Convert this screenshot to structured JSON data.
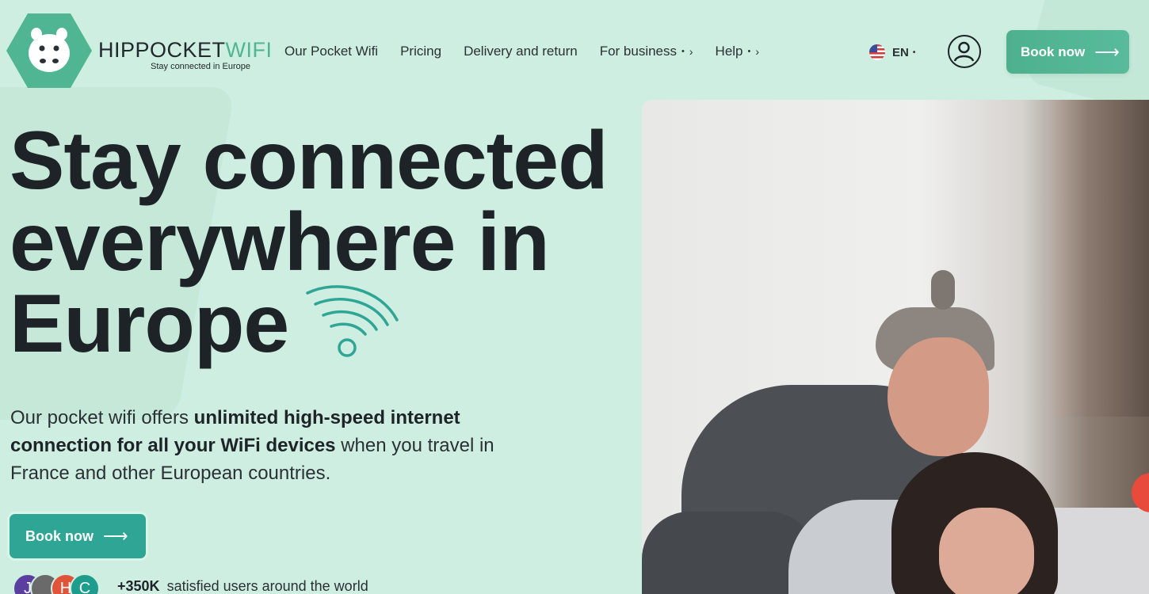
{
  "brand": {
    "name_part1": "HIPPOCKET",
    "name_part2": "WIFI",
    "tagline": "Stay connected in Europe",
    "accent": "#4fb593"
  },
  "nav": {
    "items": [
      {
        "label": "Our Pocket Wifi"
      },
      {
        "label": "Pricing"
      },
      {
        "label": "Delivery and return"
      },
      {
        "label": "For business",
        "dot": "•",
        "chevron": "›"
      },
      {
        "label": "Help",
        "dot": "•",
        "chevron": "›"
      }
    ]
  },
  "lang": {
    "code": "EN",
    "dot": "•"
  },
  "header": {
    "book_label": "Book now",
    "arrow": "⟶"
  },
  "hero": {
    "title_line1": "Stay connected",
    "title_line2": "everywhere in",
    "title_line3": "Europe",
    "text_part1": "Our pocket wifi offers ",
    "text_bold": "unlimited high-speed internet connection for all your WiFi devices",
    "text_part2": " when you travel in France and other European countries.",
    "book_label": "Book now",
    "arrow": "⟶",
    "users_count": "+350K",
    "users_text": "satisfied users around the world",
    "avatars": [
      "J",
      "",
      "H",
      "C"
    ]
  }
}
